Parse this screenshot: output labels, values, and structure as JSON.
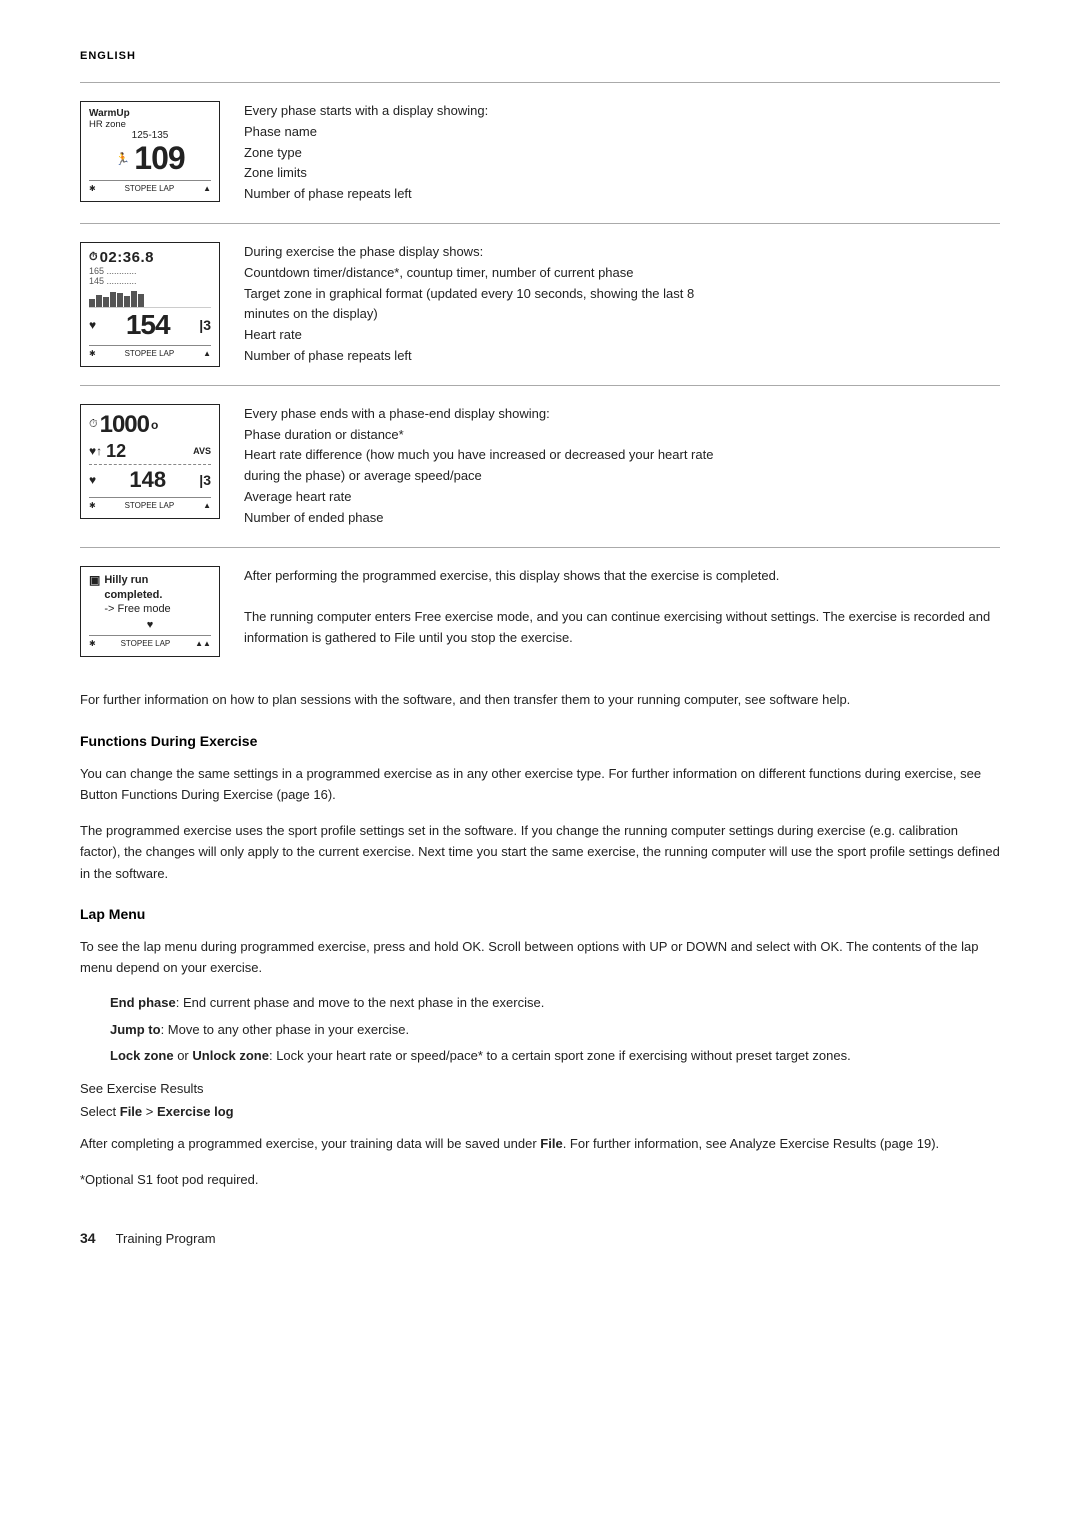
{
  "header": {
    "language_label": "ENGLISH"
  },
  "sections": [
    {
      "id": "section1",
      "description_lines": [
        "Every phase starts with a display showing:",
        "Phase name",
        "Zone type",
        "Zone limits",
        "Number of phase repeats left"
      ],
      "device": {
        "line1": "WarmUp",
        "line2": "HR zone",
        "line3": "125-135",
        "big": "109",
        "bottom": "STOPEE  LAP  ▲▲"
      }
    },
    {
      "id": "section2",
      "description_lines": [
        "During exercise the phase display shows:",
        "Countdown timer/distance*, countup timer, number of current phase",
        "Target zone in graphical format (updated every 10 seconds, showing the last 8",
        "minutes on the display)",
        "Heart rate",
        "Number of phase repeats left"
      ],
      "device": {
        "timer": "02:36.8",
        "dashes1": "165 ............",
        "num1": "145",
        "dashes2": "............",
        "big": "154",
        "phase": "3",
        "bottom": "STOPEE  LAP  ▲▲"
      }
    },
    {
      "id": "section3",
      "description_lines": [
        "Every phase ends with a phase-end display showing:",
        "Phase duration or distance*",
        "Heart rate difference (how much you have increased or decreased your heart rate",
        "during the phase) or average speed/pace",
        "Average heart rate",
        "Number of ended phase"
      ],
      "device": {
        "big": "1000",
        "unit": "o",
        "icon1": "↑",
        "num1": "12",
        "avs": "AVS",
        "num2": "148",
        "phase": "3",
        "bottom": "STOPEE  LAP  ▲▲"
      }
    },
    {
      "id": "section4",
      "description_lines": [
        "After performing the programmed exercise, this display shows that the exercise is completed.",
        "The running computer enters Free exercise mode, and you can continue exercising without settings. The exercise is recorded and information is gathered to File until you stop the exercise."
      ],
      "device": {
        "icon": "▣",
        "line1": "Hilly run",
        "line2": "completed.",
        "line3": "-> Free mode",
        "bottom": "STOPEE  LAP  ▲▲"
      }
    }
  ],
  "footer_paragraph1": "For further information on how to plan sessions with the software, and then transfer them to your running computer, see software help.",
  "functions_section": {
    "heading": "Functions During Exercise",
    "paragraph1": "You can change the same settings in a programmed exercise as in any other exercise type. For further information on different functions during exercise, see Button Functions During Exercise (page 16).",
    "paragraph2": "The programmed exercise uses the sport profile settings set in the software. If you change the running computer settings during exercise (e.g. calibration factor), the changes will only apply to the current exercise. Next time you start the same exercise, the running computer will use the sport profile settings defined in the software."
  },
  "lap_menu_section": {
    "heading": "Lap Menu",
    "intro": "To see the lap menu during programmed exercise, press and hold OK. Scroll between options with UP or DOWN and select with OK. The contents of the lap menu depend on your exercise.",
    "items": [
      {
        "term": "End phase",
        "description": ": End current phase and move to the next phase in the exercise."
      },
      {
        "term": "Jump to",
        "description": ": Move to any other phase in your exercise."
      },
      {
        "term": "Lock zone",
        "or_term": "Unlock zone",
        "description": ": Lock your heart rate or speed/pace* to a certain sport zone if exercising without preset target zones."
      }
    ],
    "see_line": "See Exercise Results",
    "select_line_prefix": "Select ",
    "select_file": "File",
    "select_arrow": " > ",
    "select_exerciselog": "Exercise log",
    "after_paragraph": "After completing a programmed exercise, your training data will be saved under ",
    "after_file": "File",
    "after_rest": ". For further information, see Analyze Exercise Results (page 19).",
    "footnote": "*Optional S1 foot pod required."
  },
  "page_footer": {
    "page_number": "34",
    "section_label": "Training Program"
  }
}
